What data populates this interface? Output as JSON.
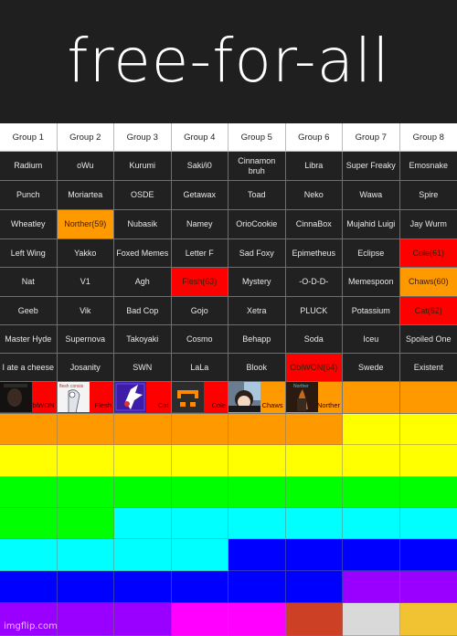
{
  "title": "free-for-all",
  "colors": {
    "dark": "#212121",
    "orange": "#ff9900",
    "red": "#ff0000",
    "yellow": "#ffff00",
    "green": "#00ff00",
    "cyan": "#00ffff",
    "blue": "#0000ff",
    "purple": "#9900ff",
    "magenta": "#ff00ff",
    "rust": "#cc4125",
    "lightgray": "#d9d9d9",
    "gold": "#f1c232"
  },
  "headers": [
    "Group 1",
    "Group 2",
    "Group 3",
    "Group 4",
    "Group 5",
    "Group 6",
    "Group 7",
    "Group 8"
  ],
  "rows": [
    [
      {
        "t": "Radium"
      },
      {
        "t": "oWu"
      },
      {
        "t": "Kurumi"
      },
      {
        "t": "Saki/i0"
      },
      {
        "t": "Cinnamon bruh"
      },
      {
        "t": "Libra"
      },
      {
        "t": "Super Freaky"
      },
      {
        "t": "Emosnake"
      }
    ],
    [
      {
        "t": "Punch"
      },
      {
        "t": "Moriartea"
      },
      {
        "t": "OSDE"
      },
      {
        "t": "Getawax"
      },
      {
        "t": "Toad"
      },
      {
        "t": "Neko"
      },
      {
        "t": "Wawa"
      },
      {
        "t": "Spire"
      }
    ],
    [
      {
        "t": "Wheatley"
      },
      {
        "t": "Norther(59)",
        "c": "orange"
      },
      {
        "t": "Nubasik"
      },
      {
        "t": "Namey"
      },
      {
        "t": "OrioCookie"
      },
      {
        "t": "CinnaBox"
      },
      {
        "t": "Mujahid Luigi"
      },
      {
        "t": "Jay Wurm"
      }
    ],
    [
      {
        "t": "Left Wing"
      },
      {
        "t": "Yakko"
      },
      {
        "t": "Foxed Memes"
      },
      {
        "t": "Letter F"
      },
      {
        "t": "Sad Foxy"
      },
      {
        "t": "Epimetheus"
      },
      {
        "t": "Eclipse"
      },
      {
        "t": "Cole(61)",
        "c": "red"
      }
    ],
    [
      {
        "t": "Nat"
      },
      {
        "t": "V1"
      },
      {
        "t": "Agh"
      },
      {
        "t": "Flesh(63)",
        "c": "red"
      },
      {
        "t": "Mystery"
      },
      {
        "t": "-O-D-D-"
      },
      {
        "t": "Memespoon"
      },
      {
        "t": "Chaws(60)",
        "c": "orange"
      }
    ],
    [
      {
        "t": "Geeb"
      },
      {
        "t": "Vik"
      },
      {
        "t": "Bad Cop"
      },
      {
        "t": "Gojo"
      },
      {
        "t": "Xetra"
      },
      {
        "t": "PLUCK"
      },
      {
        "t": "Potassium"
      },
      {
        "t": "Cat(62)",
        "c": "red"
      }
    ],
    [
      {
        "t": "Master Hyde"
      },
      {
        "t": "Supernova"
      },
      {
        "t": "Takoyaki"
      },
      {
        "t": "Cosmo"
      },
      {
        "t": "Behapp"
      },
      {
        "t": "Soda"
      },
      {
        "t": "Iceu"
      },
      {
        "t": "Spoiled One"
      }
    ],
    [
      {
        "t": "I ate a cheese"
      },
      {
        "t": "Josanity"
      },
      {
        "t": "SWN"
      },
      {
        "t": "LaLa"
      },
      {
        "t": "Blook"
      },
      {
        "t": "ObiWON(64)",
        "c": "red"
      },
      {
        "t": "Swede"
      },
      {
        "t": "Existent"
      }
    ]
  ],
  "eliminated": [
    {
      "label": "ObiWON",
      "c": "red",
      "thumb": "dark-portrait"
    },
    {
      "label": "Flesh",
      "c": "red",
      "thumb": "white-sketch"
    },
    {
      "label": "Cat",
      "c": "red",
      "thumb": "purple-bunny"
    },
    {
      "label": "Cole",
      "c": "red",
      "thumb": "orange-face"
    },
    {
      "label": "Chaws",
      "c": "orange",
      "thumb": "anime-boy"
    },
    {
      "label": "Norther",
      "c": "orange",
      "thumb": "fire-figure"
    },
    {
      "label": "",
      "c": "orange"
    },
    {
      "label": "",
      "c": "orange"
    }
  ],
  "color_rows": [
    [
      "orange",
      "orange",
      "orange",
      "orange",
      "orange",
      "orange",
      "yellow",
      "yellow"
    ],
    [
      "yellow",
      "yellow",
      "yellow",
      "yellow",
      "yellow",
      "yellow",
      "yellow",
      "yellow"
    ],
    [
      "green",
      "green",
      "green",
      "green",
      "green",
      "green",
      "green",
      "green"
    ],
    [
      "green",
      "green",
      "cyan",
      "cyan",
      "cyan",
      "cyan",
      "cyan",
      "cyan"
    ],
    [
      "cyan",
      "cyan",
      "cyan",
      "cyan",
      "blue",
      "blue",
      "blue",
      "blue"
    ],
    [
      "blue",
      "blue",
      "blue",
      "blue",
      "blue",
      "blue",
      "purple",
      "purple"
    ],
    [
      "purple",
      "purple",
      "purple",
      "magenta",
      "magenta",
      "rust",
      "lightgray",
      "gold"
    ]
  ],
  "watermark": "imgflip.com"
}
